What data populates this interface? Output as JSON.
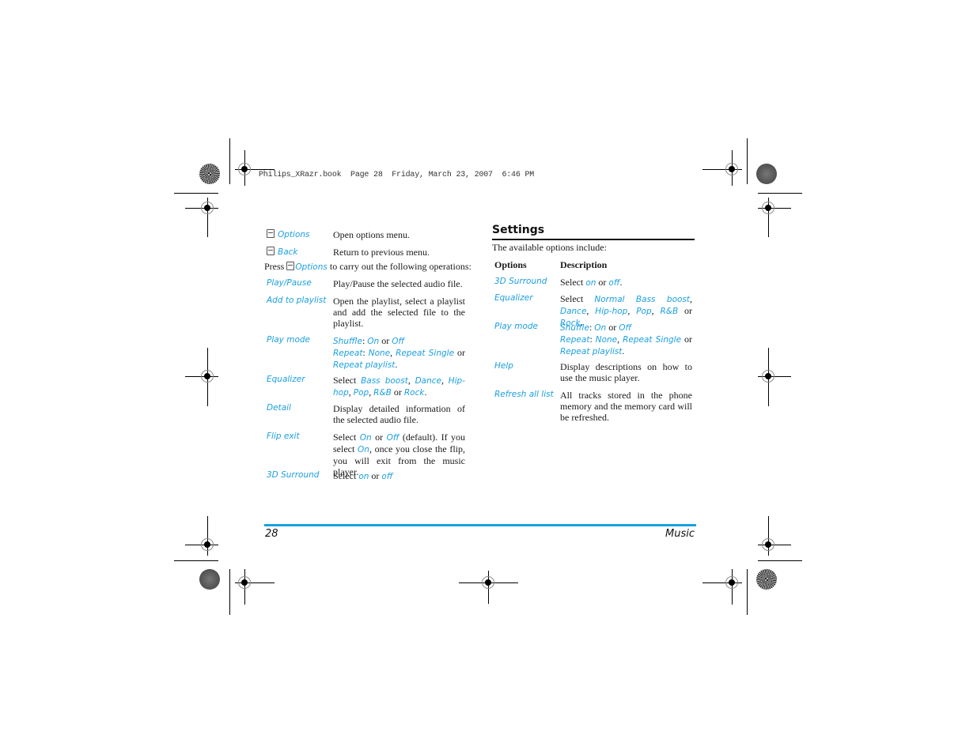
{
  "print_header": "Philips_XRazr.book  Page 28  Friday, March 23, 2007  6:46 PM",
  "left_column": {
    "softkeys": [
      {
        "icon": "left-softkey-icon",
        "label": "Options",
        "description": "Open options menu."
      },
      {
        "icon": "right-softkey-icon",
        "label": "Back",
        "description": "Return to previous menu."
      }
    ],
    "press_intro": {
      "before": "Press",
      "label": "Options",
      "after": "to carry out the following operations:"
    },
    "operations": [
      {
        "label": "Play/Pause",
        "description": "Play/Pause the selected audio file."
      },
      {
        "label": "Add to playlist",
        "description": "Open the playlist, select a playlist and add the selected file to the playlist."
      },
      {
        "label": "Play mode",
        "parts": {
          "shuffle": "Shuffle",
          "on": "On",
          "or1": "or",
          "off": "Off",
          "repeat": "Repeat",
          "none": "None",
          "repeat_single": "Repeat Single",
          "or2": "or",
          "repeat_playlist": "Repeat playlist"
        }
      },
      {
        "label": "Equalizer",
        "parts": {
          "select": "Select",
          "bass": "Bass boost",
          "dance": "Dance",
          "hiphop": "Hip-hop",
          "pop": "Pop",
          "rnb": "R&B",
          "or": "or",
          "rock": "Rock"
        }
      },
      {
        "label": "Detail",
        "description": "Display detailed information of the selected audio file."
      },
      {
        "label": "Flip exit",
        "parts": {
          "select": "Select",
          "on": "On",
          "or": "or",
          "off": "Off",
          "default": "(default). If you select",
          "on2": "On",
          "rest": ", once you close the flip, you will exit from the music player."
        }
      },
      {
        "label": "3D Surround",
        "parts": {
          "select": "Select",
          "on": "on",
          "or": "or",
          "off": "off"
        }
      }
    ]
  },
  "right_column": {
    "heading": "Settings",
    "intro": "The available options include:",
    "table_headers": {
      "options": "Options",
      "description": "Description"
    },
    "rows": [
      {
        "label": "3D Surround",
        "parts": {
          "select": "Select",
          "on": "on",
          "or": "or",
          "off": "off",
          "end": "."
        }
      },
      {
        "label": "Equalizer",
        "parts": {
          "select": "Select",
          "normal_bass": "Normal Bass boost",
          "dance": "Dance",
          "hiphop": "Hip-hop",
          "pop": "Pop",
          "rnb": "R&B",
          "or": "or",
          "rock": "Rock"
        }
      },
      {
        "label": "Play mode",
        "parts": {
          "shuffle": "Shuffle",
          "on": "On",
          "or1": "or",
          "off": "Off",
          "repeat": "Repeat",
          "none": "None",
          "repeat_single": "Repeat Single",
          "or2": "or",
          "repeat_playlist": "Repeat playlist"
        }
      },
      {
        "label": "Help",
        "description": "Display descriptions on how to use the music player."
      },
      {
        "label": "Refresh all list",
        "description": "All tracks stored in the phone memory and the memory card will be refreshed."
      }
    ]
  },
  "footer": {
    "page_number": "28",
    "section": "Music"
  },
  "colors": {
    "accent": "#1a9fe0",
    "text": "#1a1a1a"
  }
}
